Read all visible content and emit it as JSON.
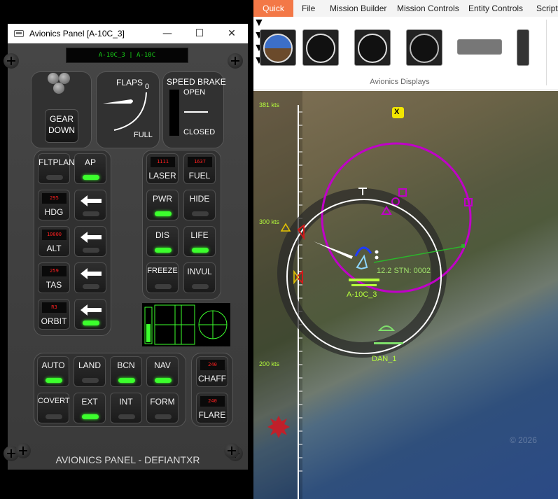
{
  "left_window": {
    "title": "Avionics Panel  [A-10C_3]",
    "controls": {
      "minimize": "—",
      "maximize": "☐",
      "close": "✕"
    },
    "top_display": "A-10C_3   |   A-10C",
    "gear": {
      "line1": "GEAR",
      "line2": "DOWN"
    },
    "flaps": {
      "title": "FLAPS",
      "min": "0",
      "max": "FULL"
    },
    "speed_brake": {
      "title": "SPEED BRAKE",
      "open": "OPEN",
      "closed": "CLOSED"
    },
    "left_buttons": [
      {
        "label": "FLTPLAN",
        "display": "",
        "led_on": false
      },
      {
        "label": "AP",
        "display": "",
        "led_on": true
      },
      {
        "label": "HDG",
        "display": "295",
        "led_on": false
      },
      {
        "label": "ALT",
        "display": "10000",
        "led_on": false
      },
      {
        "label": "TAS",
        "display": "259",
        "led_on": false
      },
      {
        "label": "ORBIT",
        "display": "R3",
        "led_on": true
      }
    ],
    "right_buttons": [
      {
        "label": "LASER",
        "display": "1111"
      },
      {
        "label": "FUEL",
        "display": "1637"
      },
      {
        "label": "PWR",
        "led_on": true
      },
      {
        "label": "HIDE",
        "led_on": false
      },
      {
        "label": "DIS",
        "led_on": true
      },
      {
        "label": "LIFE",
        "led_on": true
      },
      {
        "label": "FREEZE",
        "led_on": false
      },
      {
        "label": "INVUL",
        "led_on": false
      }
    ],
    "bottom_buttons": [
      {
        "label": "AUTO",
        "led_on": true
      },
      {
        "label": "LAND",
        "led_on": false
      },
      {
        "label": "BCN",
        "led_on": true
      },
      {
        "label": "NAV",
        "led_on": true
      },
      {
        "label": "COVERT",
        "led_on": false
      },
      {
        "label": "EXT",
        "led_on": true
      },
      {
        "label": "INT",
        "led_on": false
      },
      {
        "label": "FORM",
        "led_on": false
      }
    ],
    "chaff": {
      "label": "CHAFF",
      "display": "240"
    },
    "flare": {
      "label": "FLARE",
      "display": "240"
    },
    "footer": "AVIONICS PANEL - DEFIANTXR"
  },
  "app": {
    "menu": [
      "Quick",
      "File",
      "Mission Builder",
      "Mission Controls",
      "Entity  Controls",
      "Script"
    ],
    "ribbon_group": "Avionics Displays",
    "ribbon_icons": [
      "attitude-indicator-icon",
      "altimeter-icon",
      "airspeed-indicator-icon",
      "hsi-icon",
      "panel-strip-icon",
      "radio-panel-icon"
    ],
    "map": {
      "speed_marks": [
        "381 kts",
        "300 kts",
        "200 kts"
      ],
      "entity_own": "A-10C_3",
      "entity_other": "DAN_1",
      "track_label": "12.2 STN: 0002",
      "waypoint_label": "X",
      "watermark": "© 2026"
    }
  }
}
